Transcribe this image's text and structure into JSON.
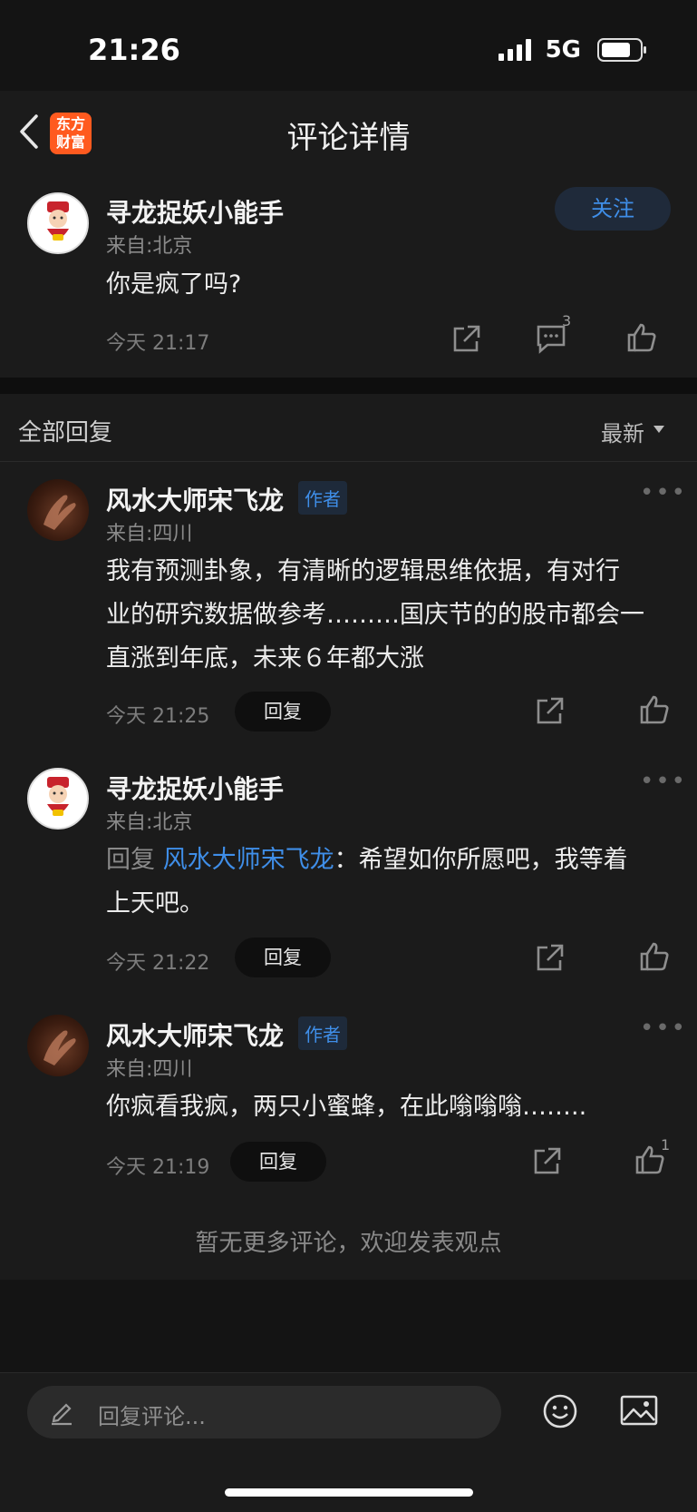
{
  "status_bar": {
    "time": "21:26",
    "network": "5G"
  },
  "nav": {
    "title": "评论详情",
    "logo_text": "东方财富"
  },
  "main_comment": {
    "username": "寻龙捉妖小能手",
    "location": "来自:北京",
    "content": "你是疯了吗?",
    "time": "今天 21:17",
    "follow_label": "关注",
    "comment_count": "3"
  },
  "replies_section": {
    "title": "全部回复",
    "sort_label": "最新"
  },
  "replies": [
    {
      "username": "风水大师宋飞龙",
      "tag": "作者",
      "location": "来自:四川",
      "content_lines": [
        "我有预测卦象，有清晰的逻辑思维依据，有对行",
        "业的研究数据做参考………国庆节的的股市都会一",
        "直涨到年底，未来６年都大涨"
      ],
      "time": "今天 21:25",
      "reply_label": "回复"
    },
    {
      "username": "寻龙捉妖小能手",
      "location": "来自:北京",
      "reply_prefix": "回复",
      "mention": "风水大师宋飞龙",
      "content_line1": "：希望如你所愿吧，我等着",
      "content_line2": "上天吧。",
      "time": "今天 21:22",
      "reply_label": "回复"
    },
    {
      "username": "风水大师宋飞龙",
      "tag": "作者",
      "location": "来自:四川",
      "content": "你疯看我疯，两只小蜜蜂，在此嗡嗡嗡……..",
      "time": "今天 21:19",
      "reply_label": "回复",
      "like_count": "1"
    }
  ],
  "footer_note": "暂无更多评论，欢迎发表观点",
  "bottom_bar": {
    "input_placeholder": "回复评论..."
  }
}
